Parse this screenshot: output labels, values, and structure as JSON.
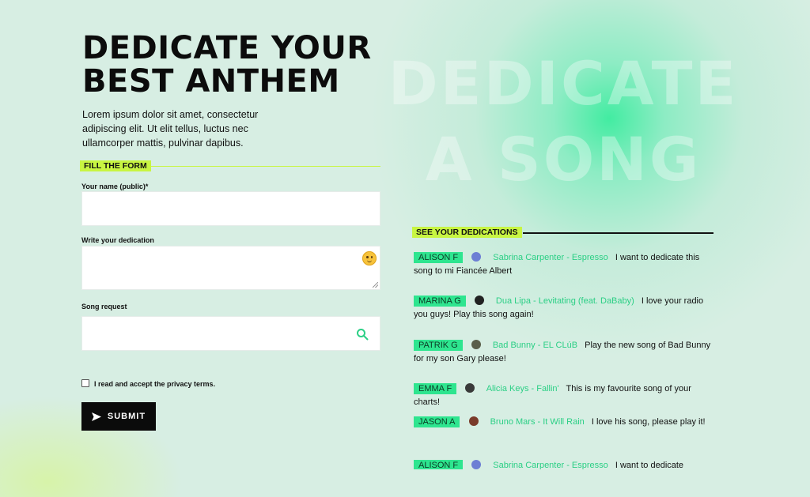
{
  "background": {
    "line1": "DEDICATE",
    "line2": "A SONG"
  },
  "header": {
    "title_line1": "DEDICATE YOUR",
    "title_line2": "BEST ANTHEM",
    "intro": "Lorem ipsum dolor sit amet, consectetur adipiscing elit. Ut elit tellus, luctus nec ullamcorper mattis, pulvinar dapibus."
  },
  "form": {
    "section_title": "FILL THE FORM",
    "name_label": "Your name (public)*",
    "dedication_label": "Write your dedication",
    "song_label": "Song request",
    "privacy_label": "I read and accept the privacy terms.",
    "submit_label": "SUBMIT",
    "emoji_icon": "smiley-emoji-icon",
    "search_icon": "search-icon"
  },
  "dedications": {
    "section_title": "SEE YOUR DEDICATIONS",
    "items": [
      {
        "name": "ALISON F",
        "song": "Sabrina Carpenter - Espresso",
        "message": "I want to dedicate this song to mi Fiancée Albert",
        "avatar_color": "#6d7fd4"
      },
      {
        "name": "MARINA G",
        "song": "Dua Lipa - Levitating (feat. DaBaby)",
        "message": "I love your radio you guys! Play this song again!",
        "avatar_color": "#222222"
      },
      {
        "name": "PATRIK G",
        "song": "Bad Bunny - EL CLúB",
        "message": "Play the new song of Bad Bunny for my son Gary please!",
        "avatar_color": "#5a5f4a"
      },
      {
        "name": "EMMA F",
        "song": "Alicia Keys - Fallin'",
        "message": "This is my favourite song of your charts!",
        "avatar_color": "#3a3a3a"
      },
      {
        "name": "JASON A",
        "song": "Bruno Mars - It Will Rain",
        "message": "I love his song, please play it!",
        "avatar_color": "#7a3b2a"
      },
      {
        "name": "ALISON F",
        "song": "Sabrina Carpenter - Espresso",
        "message": "I want to dedicate",
        "avatar_color": "#6d7fd4"
      }
    ]
  }
}
